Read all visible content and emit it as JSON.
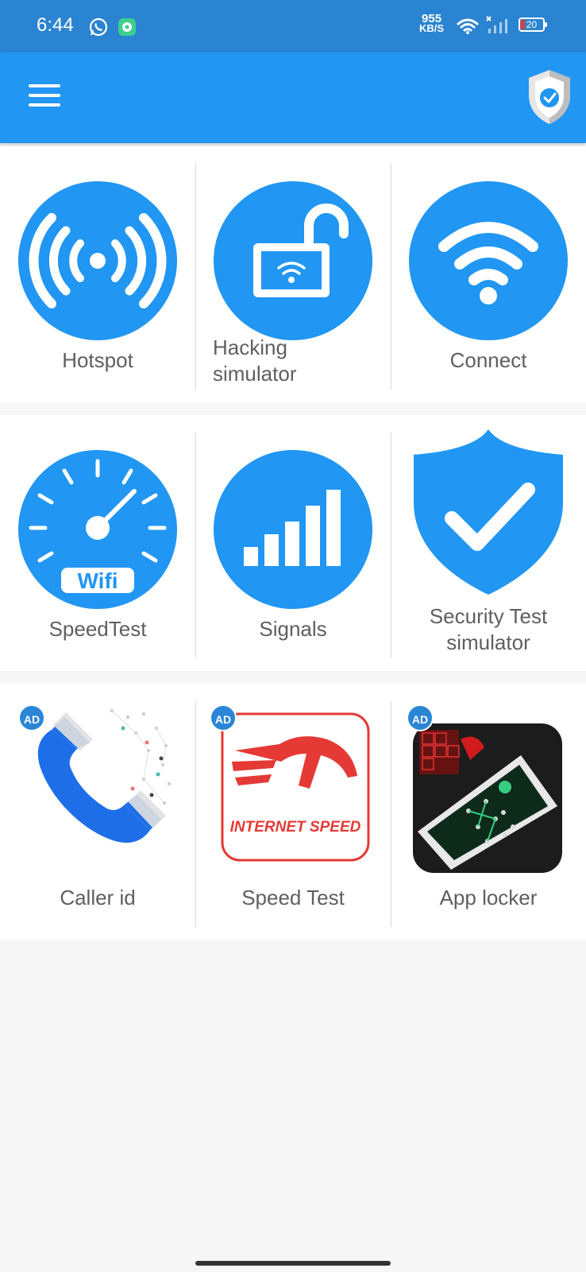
{
  "status_bar": {
    "time": "6:44",
    "net_speed_value": "955",
    "net_speed_unit": "KB/S",
    "battery": "20"
  },
  "colors": {
    "status_bar": "#2b84d1",
    "app_bar": "#2196f3",
    "icon_blue": "#2196f3",
    "label": "#5f5f5f",
    "ad_badge": "#2a86d6"
  },
  "app_bar": {
    "menu_icon": "hamburger-menu-icon",
    "logo_icon": "shield-check-icon"
  },
  "grid": {
    "row1": [
      {
        "label": "Hotspot",
        "icon": "hotspot-icon"
      },
      {
        "label": "Hacking simulator",
        "icon": "unlock-wifi-icon"
      },
      {
        "label": "Connect",
        "icon": "wifi-icon"
      }
    ],
    "row2": [
      {
        "label": "SpeedTest",
        "icon": "speedometer-wifi-icon",
        "icon_text": "Wifi"
      },
      {
        "label": "Signals",
        "icon": "signal-bars-icon"
      },
      {
        "label": "Security Test simulator",
        "icon": "shield-check-icon"
      }
    ],
    "row3": [
      {
        "label": "Caller id",
        "icon": "phone-icon",
        "badge": "AD"
      },
      {
        "label": "Speed Test",
        "icon": "internet-speed-icon",
        "badge": "AD",
        "icon_text": "INTERNET SPEED"
      },
      {
        "label": "App locker",
        "icon": "phone-lock-icon",
        "badge": "AD"
      }
    ]
  }
}
